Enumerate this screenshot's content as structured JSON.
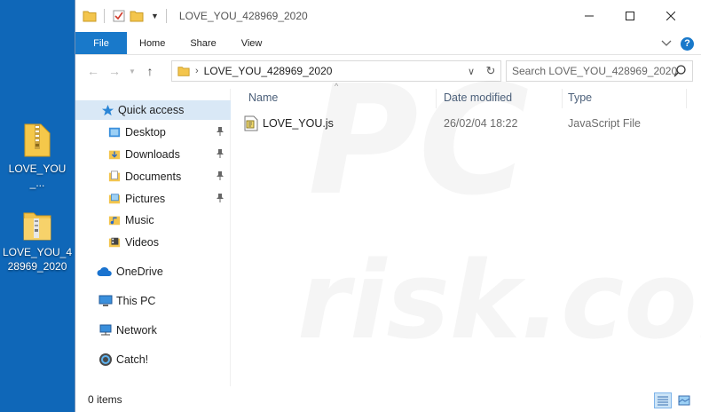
{
  "desktop": {
    "icons": [
      {
        "label": "LOVE_YOU_...",
        "kind": "zip-folder"
      },
      {
        "label": "LOVE_YOU_428969_2020",
        "kind": "zip-folder"
      }
    ]
  },
  "window": {
    "title": "LOVE_YOU_428969_2020",
    "ribbon": {
      "tabs": [
        "File",
        "Home",
        "Share",
        "View"
      ]
    },
    "address": {
      "path": "LOVE_YOU_428969_2020"
    },
    "search": {
      "placeholder": "Search LOVE_YOU_428969_2020"
    },
    "nav": {
      "quick_access": "Quick access",
      "items": [
        {
          "label": "Desktop",
          "pinned": true
        },
        {
          "label": "Downloads",
          "pinned": true
        },
        {
          "label": "Documents",
          "pinned": true
        },
        {
          "label": "Pictures",
          "pinned": true
        },
        {
          "label": "Music",
          "pinned": false
        },
        {
          "label": "Videos",
          "pinned": false
        }
      ],
      "onedrive": "OneDrive",
      "this_pc": "This PC",
      "network": "Network",
      "catch": "Catch!"
    },
    "columns": [
      "Name",
      "Date modified",
      "Type"
    ],
    "files": [
      {
        "name": "LOVE_YOU.js",
        "date": "26/02/04 18:22",
        "type": "JavaScript File"
      }
    ],
    "status": {
      "items": "0 items"
    },
    "watermark": {
      "line1": "PC",
      "line2": "risk.com"
    },
    "colors": {
      "desktop": "#0f67b8",
      "accent": "#1979ca",
      "selection": "#d9e8f6"
    }
  }
}
